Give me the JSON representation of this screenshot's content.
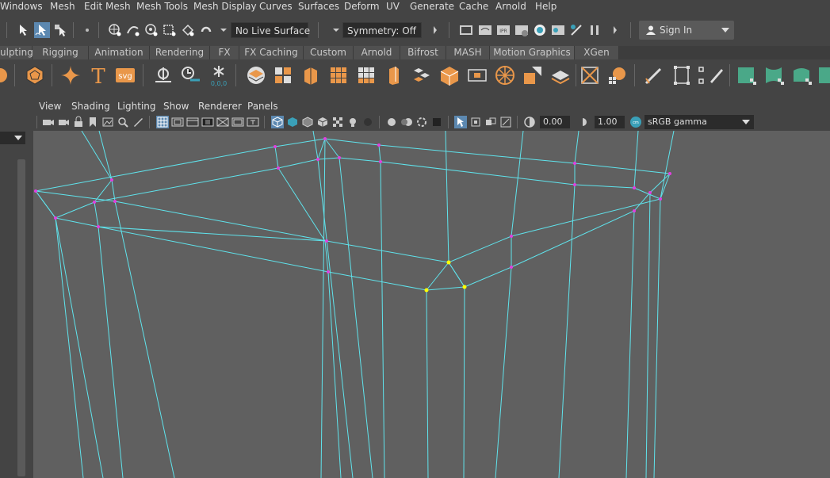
{
  "menubar": {
    "items": [
      "Windows",
      "Mesh",
      "Edit Mesh",
      "Mesh Tools",
      "Mesh Display",
      "Curves",
      "Surfaces",
      "Deform",
      "UV",
      "Generate",
      "Cache",
      "Arnold",
      "Help"
    ]
  },
  "statusline": {
    "live_surface": "No Live Surface",
    "symmetry": "Symmetry: Off",
    "sign_in": "Sign In"
  },
  "shelf_tabs": [
    "ulpting",
    "Rigging",
    "Animation",
    "Rendering",
    "FX",
    "FX Caching",
    "Custom",
    "Arnold",
    "Bifrost",
    "MASH",
    "Motion Graphics",
    "XGen"
  ],
  "shelf": {
    "text_tool_glyph": "T",
    "svg_tool_label": "svg",
    "snowflake_readout": "0,0,0"
  },
  "panel_menu": [
    "View",
    "Shading",
    "Lighting",
    "Show",
    "Renderer",
    "Panels"
  ],
  "panel_toolbar": {
    "exposure": "0.00",
    "gamma": "1.00",
    "color_space": "sRGB gamma"
  },
  "colors": {
    "wire": "#5fe3ec",
    "vertex": "#e040e0",
    "selected_vertex": "#ffff00",
    "viewport_bg": "#606060",
    "shelf_orange": "#e9974a"
  }
}
